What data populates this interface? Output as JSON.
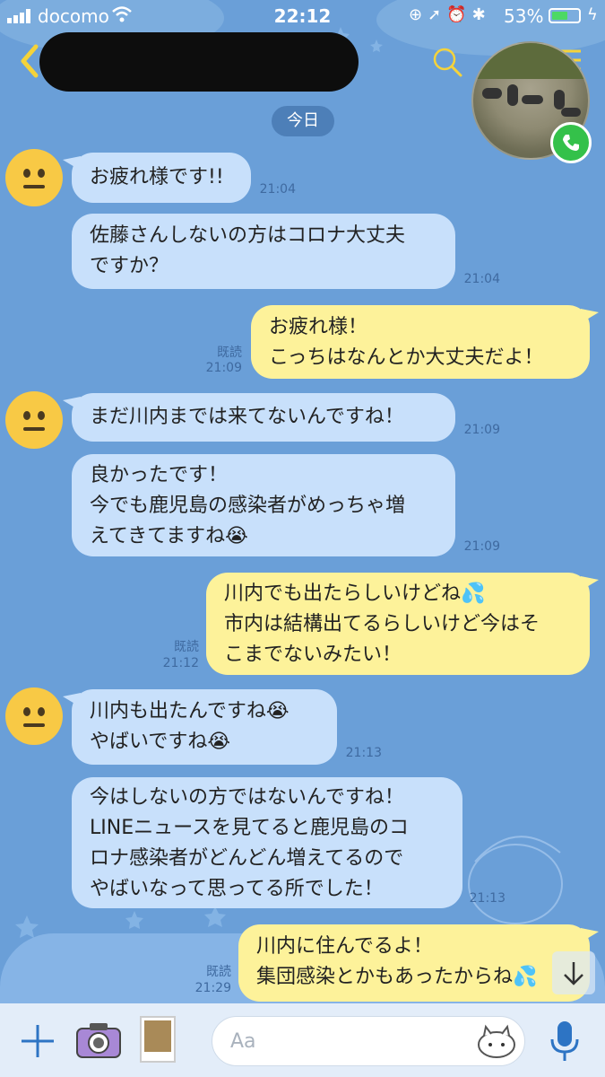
{
  "status_bar": {
    "carrier": "docomo",
    "time": "22:12",
    "battery": "53%"
  },
  "header": {
    "back_icon": "chevron-left-icon",
    "contact_name_redacted": true,
    "search_icon": "search-icon",
    "menu_icon": "menu-icon",
    "call_icon": "phone-icon"
  },
  "date_label": "今日",
  "messages": [
    {
      "dir": "in",
      "text": "お疲れ様です!!",
      "time": "21:04",
      "read": ""
    },
    {
      "dir": "in",
      "text": "佐藤さんしないの方はコロナ大丈夫\nですか？",
      "time": "21:04",
      "read": ""
    },
    {
      "dir": "out",
      "text": "お疲れ様！\nこっちはなんとか大丈夫だよ！",
      "time": "21:09",
      "read": "既読"
    },
    {
      "dir": "in",
      "text": "まだ川内までは来てないんですね！",
      "time": "21:09",
      "read": ""
    },
    {
      "dir": "in",
      "text": "良かったです！\n今でも鹿児島の感染者がめっちゃ増\nえてきてますね😭",
      "time": "21:09",
      "read": ""
    },
    {
      "dir": "out",
      "text": "川内でも出たらしいけどね💦\n市内は結構出てるらしいけど今はそ\nこまでないみたい！",
      "time": "21:12",
      "read": "既読"
    },
    {
      "dir": "in",
      "text": "川内も出たんですね😭\nやばいですね😭",
      "time": "21:13",
      "read": ""
    },
    {
      "dir": "in",
      "text": "今はしないの方ではないんですね！\nLINEニュースを見てると鹿児島のコ\nロナ感染者がどんどん増えてるので\nやばいなって思ってる所でした！",
      "time": "21:13",
      "read": ""
    },
    {
      "dir": "out",
      "text": "川内に住んでるよ！\n集団感染とかもあったからね💦",
      "time": "21:29",
      "read": "既読"
    }
  ],
  "input": {
    "placeholder": "Aa"
  },
  "colors": {
    "background": "#6a9fd8",
    "incoming_bubble": "#c8e0fb",
    "outgoing_bubble": "#fdf29a",
    "input_bar": "#e3edf9"
  }
}
